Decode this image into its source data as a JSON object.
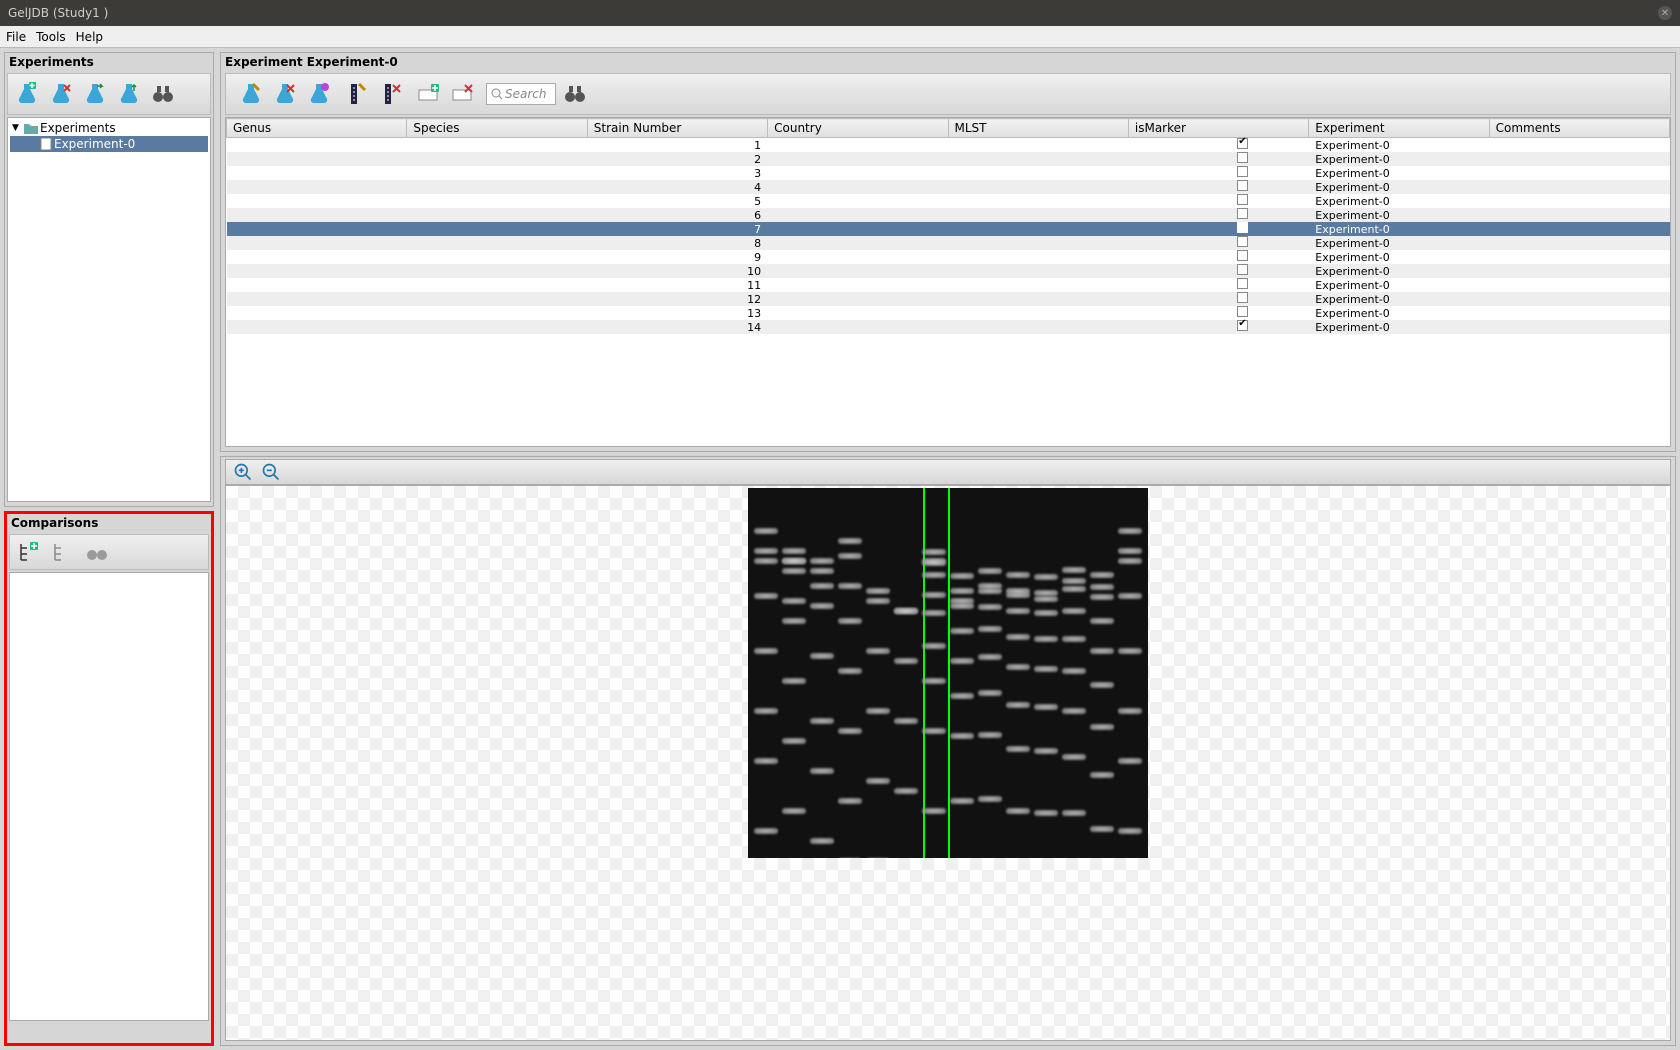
{
  "window": {
    "title": "GelJDB (Study1 )"
  },
  "menu": {
    "file": "File",
    "tools": "Tools",
    "help": "Help"
  },
  "experiments_panel": {
    "title": "Experiments",
    "tree_root": "Experiments",
    "tree_item": "Experiment-0"
  },
  "comparisons_panel": {
    "title": "Comparisons"
  },
  "detail_panel": {
    "title": "Experiment Experiment-0",
    "search_placeholder": "Search",
    "columns": [
      "Genus",
      "Species",
      "Strain Number",
      "Country",
      "MLST",
      "isMarker",
      "Experiment",
      "Comments"
    ],
    "rows": [
      {
        "strain": "1",
        "isMarker": true,
        "experiment": "Experiment-0"
      },
      {
        "strain": "2",
        "isMarker": false,
        "experiment": "Experiment-0"
      },
      {
        "strain": "3",
        "isMarker": false,
        "experiment": "Experiment-0"
      },
      {
        "strain": "4",
        "isMarker": false,
        "experiment": "Experiment-0"
      },
      {
        "strain": "5",
        "isMarker": false,
        "experiment": "Experiment-0"
      },
      {
        "strain": "6",
        "isMarker": false,
        "experiment": "Experiment-0"
      },
      {
        "strain": "7",
        "isMarker": false,
        "experiment": "Experiment-0",
        "selected": true
      },
      {
        "strain": "8",
        "isMarker": false,
        "experiment": "Experiment-0"
      },
      {
        "strain": "9",
        "isMarker": false,
        "experiment": "Experiment-0"
      },
      {
        "strain": "10",
        "isMarker": false,
        "experiment": "Experiment-0"
      },
      {
        "strain": "11",
        "isMarker": false,
        "experiment": "Experiment-0"
      },
      {
        "strain": "12",
        "isMarker": false,
        "experiment": "Experiment-0"
      },
      {
        "strain": "13",
        "isMarker": false,
        "experiment": "Experiment-0"
      },
      {
        "strain": "14",
        "isMarker": true,
        "experiment": "Experiment-0"
      }
    ]
  },
  "icons": {
    "flask_add": "flask-add-icon",
    "flask_del": "flask-del-icon",
    "flask_next": "flask-next-icon",
    "flask_up": "flask-up-icon",
    "binoculars": "binoculars-icon",
    "edit_lane": "edit-lane-icon",
    "delete_lane": "delete-lane-icon",
    "marker_add": "marker-add-icon",
    "marker_del": "marker-del-icon",
    "tree_add": "tree-add-icon",
    "tree": "tree-icon",
    "zoom_in": "zoom-in-icon",
    "zoom_out": "zoom-out-icon",
    "folder": "folder-icon",
    "file": "file-icon"
  }
}
